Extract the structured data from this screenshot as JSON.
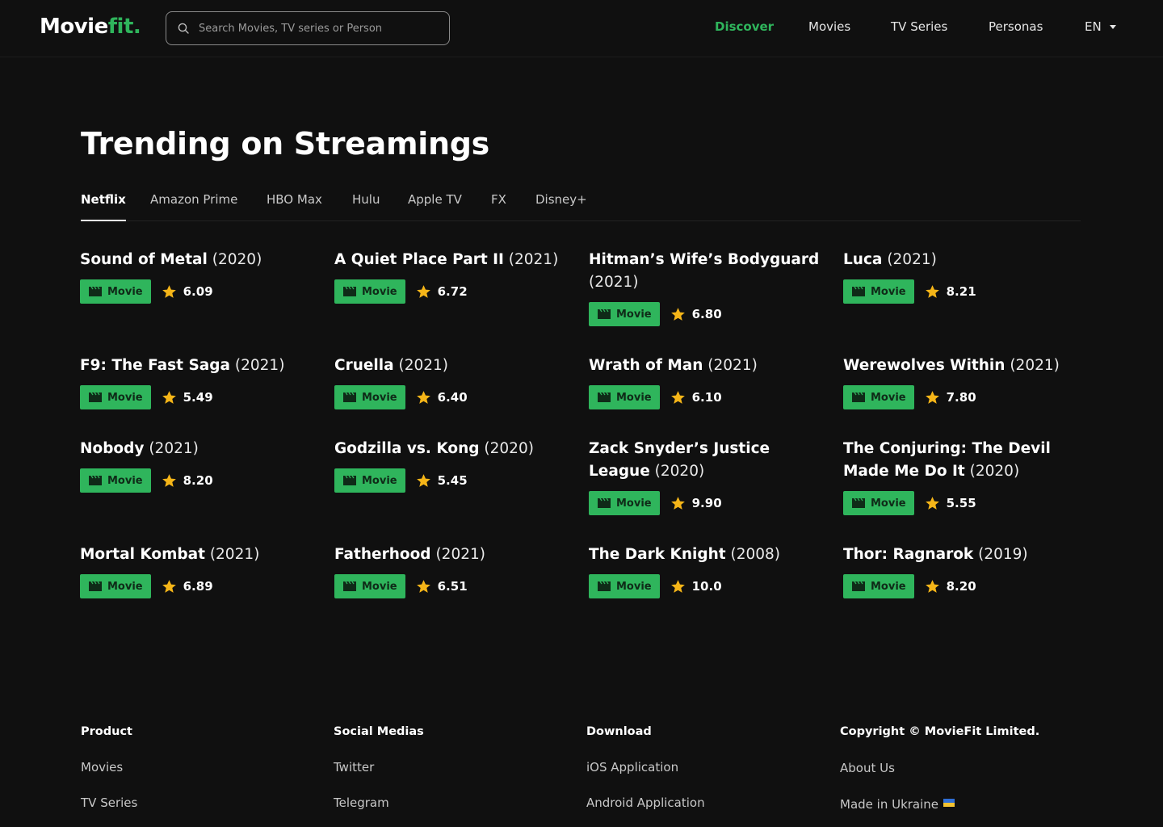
{
  "brand": {
    "logo_main": "Movie",
    "logo_accent": "fit."
  },
  "search": {
    "placeholder": "Search Movies, TV series or Person"
  },
  "nav": {
    "discover": "Discover",
    "movies": "Movies",
    "tv_series": "TV Series",
    "personas": "Personas",
    "language": "EN"
  },
  "page": {
    "title": "Trending on Streamings"
  },
  "tabs": [
    "Netflix",
    "Amazon Prime",
    "HBO Max",
    "Hulu",
    "Apple TV",
    "FX",
    "Disney+"
  ],
  "items": [
    {
      "title": "Sound of Metal",
      "year": "(2020)",
      "type": "Movie",
      "rating": "6.09"
    },
    {
      "title": "A Quiet Place Part II",
      "year": "(2021)",
      "type": "Movie",
      "rating": "6.72"
    },
    {
      "title": "Hitman’s Wife’s Bodyguard",
      "year": "(2021)",
      "type": "Movie",
      "rating": "6.80"
    },
    {
      "title": "Luca",
      "year": "(2021)",
      "type": "Movie",
      "rating": "8.21"
    },
    {
      "title": "F9: The Fast Saga",
      "year": "(2021)",
      "type": "Movie",
      "rating": "5.49"
    },
    {
      "title": "Cruella",
      "year": "(2021)",
      "type": "Movie",
      "rating": "6.40"
    },
    {
      "title": "Wrath of Man",
      "year": "(2021)",
      "type": "Movie",
      "rating": "6.10"
    },
    {
      "title": "Werewolves Within",
      "year": "(2021)",
      "type": "Movie",
      "rating": "7.80"
    },
    {
      "title": "Nobody",
      "year": "(2021)",
      "type": "Movie",
      "rating": "8.20"
    },
    {
      "title": "Godzilla vs. Kong",
      "year": "(2020)",
      "type": "Movie",
      "rating": "5.45"
    },
    {
      "title": "Zack Snyder’s Justice League",
      "year": "(2020)",
      "type": "Movie",
      "rating": "9.90"
    },
    {
      "title": "The Conjuring: The Devil Made Me Do It",
      "year": "(2020)",
      "type": "Movie",
      "rating": "5.55"
    },
    {
      "title": "Mortal Kombat",
      "year": "(2021)",
      "type": "Movie",
      "rating": "6.89"
    },
    {
      "title": "Fatherhood",
      "year": "(2021)",
      "type": "Movie",
      "rating": "6.51"
    },
    {
      "title": "The Dark Knight",
      "year": "(2008)",
      "type": "Movie",
      "rating": "10.0"
    },
    {
      "title": "Thor: Ragnarok",
      "year": "(2019)",
      "type": "Movie",
      "rating": "8.20"
    }
  ],
  "footer": {
    "product": {
      "heading": "Product",
      "links": [
        "Movies",
        "TV Series"
      ]
    },
    "social": {
      "heading": "Social Medias",
      "links": [
        "Twitter",
        "Telegram"
      ]
    },
    "download": {
      "heading": "Download",
      "links": [
        "iOS Application",
        "Android Application"
      ]
    },
    "company": {
      "heading": "Copyright © MovieFit Limited.",
      "links": [
        "About Us",
        "Made in Ukraine"
      ]
    }
  },
  "colors": {
    "accent": "#2fb55c",
    "background": "#101010",
    "star": "#f5b518"
  }
}
